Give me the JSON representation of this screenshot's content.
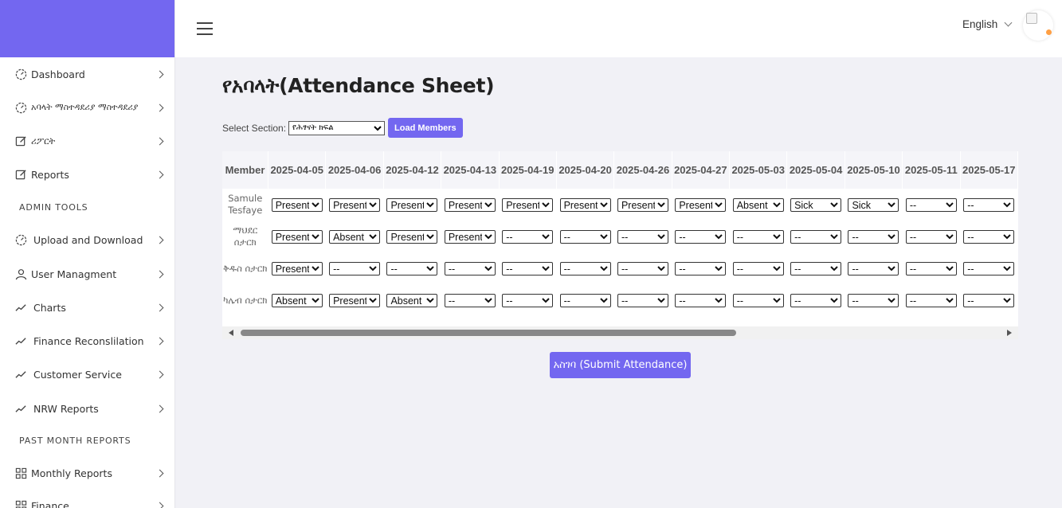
{
  "sidebar": {
    "items": [
      {
        "label": "Dashboard",
        "icon": "gauge-icon"
      },
      {
        "label": "አባላት ማስተዳደሪያ ማስተዳደሪያ",
        "icon": "gauge-icon"
      },
      {
        "label": "ሪፖርት",
        "icon": "edit-icon"
      },
      {
        "label": "Reports",
        "icon": "edit-icon"
      },
      {
        "label": "Upload and Download",
        "icon": "gauge-icon"
      },
      {
        "label": "User Managment",
        "icon": "user-icon"
      },
      {
        "label": "Charts",
        "icon": "trend-icon"
      },
      {
        "label": "Finance Reconslilation",
        "icon": "trend-icon"
      },
      {
        "label": "Customer Service",
        "icon": "trend-icon"
      },
      {
        "label": "NRW Reports",
        "icon": "trend-icon"
      },
      {
        "label": "Monthly Reports",
        "icon": "grid-icon"
      },
      {
        "label": "Finance",
        "icon": "grid-icon"
      }
    ],
    "sections": {
      "admin_tools": "ADMIN TOOLS",
      "past_month": "PAST MONTH REPORTS"
    }
  },
  "header": {
    "language": "English"
  },
  "page": {
    "title": "የአባላት(Attendance Sheet)",
    "section_label": "Select Section:",
    "section_value": "የሕፃናት ክፍል",
    "load_button": "Load Members",
    "submit_button": "አስገባ (Submit Attendance)"
  },
  "table": {
    "member_header": "Member",
    "dates": [
      "2025-04-05",
      "2025-04-06",
      "2025-04-12",
      "2025-04-13",
      "2025-04-19",
      "2025-04-20",
      "2025-04-26",
      "2025-04-27",
      "2025-05-03",
      "2025-05-04",
      "2025-05-10",
      "2025-05-11",
      "2025-05-17"
    ],
    "rows": [
      {
        "member": "Samule Tesfaye",
        "values": [
          "Present",
          "Present",
          "Present",
          "Present",
          "Present",
          "Present",
          "Present",
          "Present",
          "Absent",
          "Sick",
          "Sick",
          "--",
          "--"
        ]
      },
      {
        "member": "ማህደር ሰታርክ",
        "values": [
          "Present",
          "Absent",
          "Present",
          "Present",
          "--",
          "--",
          "--",
          "--",
          "--",
          "--",
          "--",
          "--",
          "--"
        ]
      },
      {
        "member": "ቅዱስ ሰታርክ",
        "values": [
          "Present",
          "--",
          "--",
          "--",
          "--",
          "--",
          "--",
          "--",
          "--",
          "--",
          "--",
          "--",
          "--"
        ]
      },
      {
        "member": "ካሌብ ሰታርክ",
        "values": [
          "Absent",
          "Present",
          "Absent",
          "--",
          "--",
          "--",
          "--",
          "--",
          "--",
          "--",
          "--",
          "--",
          "--"
        ]
      }
    ],
    "options": [
      "--",
      "Present",
      "Absent",
      "Sick"
    ]
  },
  "colors": {
    "accent": "#7367f0",
    "background": "#f1f1f6"
  }
}
